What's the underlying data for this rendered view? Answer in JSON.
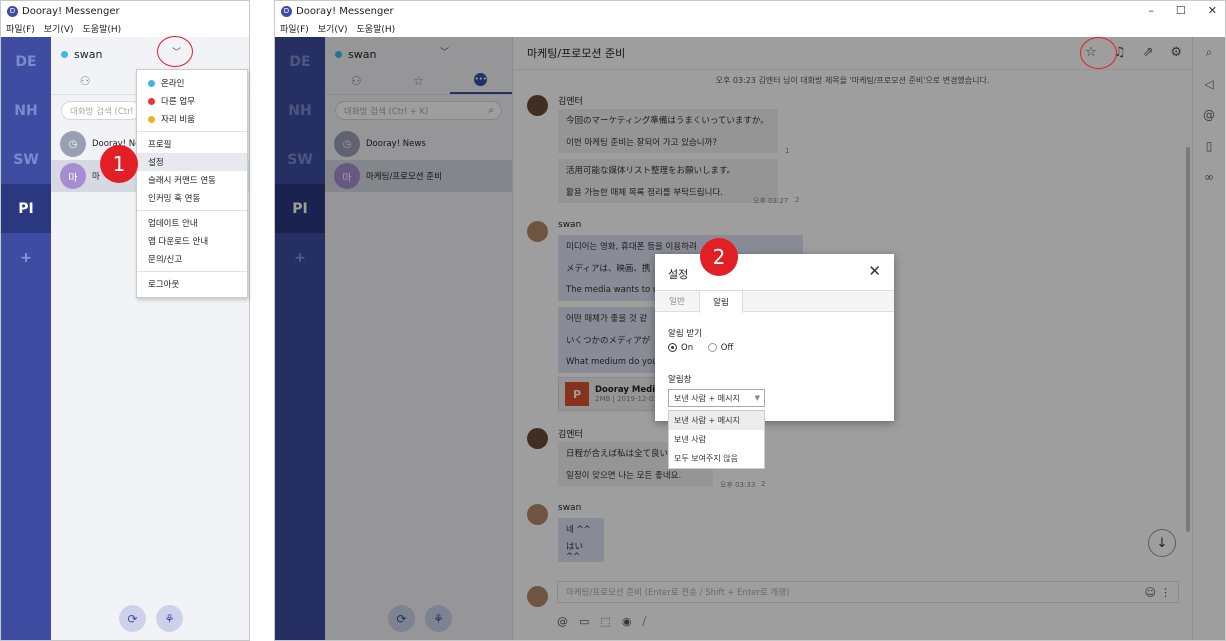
{
  "app_title": "Dooray! Messenger",
  "menu": [
    "파일(F)",
    "보기(V)",
    "도움말(H)"
  ],
  "window_controls": [
    "–",
    "☐",
    "✕"
  ],
  "workspaces": [
    "DE",
    "NH",
    "SW",
    "PI",
    "+"
  ],
  "user": {
    "name": "swan",
    "status_color": "#3fb7e8"
  },
  "search_placeholder_left": "대화방 검색 (Ctrl",
  "search_placeholder": "대화방 검색 (Ctrl + K)",
  "rooms": [
    {
      "name": "Dooray! News",
      "avatar": "◷",
      "avatar_color": "#9aa0b4"
    },
    {
      "name": "마케팅/프로모션 준비",
      "avatar": "마",
      "avatar_color": "#a68dd3"
    }
  ],
  "left_rooms_truncated": [
    "Dooray! Ne",
    "마"
  ],
  "dropdown": {
    "status": [
      {
        "label": "온라인",
        "color": "#3fb7e8"
      },
      {
        "label": "다른 업무",
        "color": "#e8343a"
      },
      {
        "label": "자리 비움",
        "color": "#f2b11b"
      }
    ],
    "group2": [
      "프로필",
      "설정",
      "슬래시 커맨드 연동",
      "인커밍 훅 연동"
    ],
    "group3": [
      "업데이트 안내",
      "앱 다운로드 안내",
      "문의/신고"
    ],
    "group4": [
      "로그아웃"
    ]
  },
  "steps": [
    "1",
    "2"
  ],
  "chat": {
    "title": "마케팅/프로모션 준비",
    "system_message": "오후 03:23  김엔터 님이 대화방 제목을 '마케팅/프로모션 준비'으로 변경했습니다.",
    "messages": [
      {
        "sender": "김엔터",
        "lines": [
          "今回のマーケティング準備はうまくいっていますか。",
          "이번 마케팅 준비는 잘되어 가고 있습니까?"
        ],
        "count": "1"
      },
      {
        "sender": "",
        "lines": [
          "活用可能な媒体リスト整理をお願いします。",
          "활용 가능한 매체 목록 정리를 부탁드립니다."
        ],
        "time": "오후 03:27",
        "count": "2"
      },
      {
        "sender": "swan",
        "lines": [
          "미디어는 영화, 휴대폰 등을 이용하려",
          "メディアは、映画、携",
          "The media wants to u"
        ]
      },
      {
        "sender": "",
        "lines": [
          "어떤 매체가 좋을 것 같",
          "いくつかのメディアが",
          "What medium do you"
        ]
      },
      {
        "sender": "",
        "file": {
          "name": "Dooray Media.p",
          "meta": "2MB | 2019-12-03"
        }
      },
      {
        "sender": "김엔터",
        "lines": [
          "日程が合えば私は全て良い",
          "일정이 맞으면 나는 모든 좋네요."
        ],
        "time": "오후 03:33",
        "count": "2"
      },
      {
        "sender": "swan",
        "lines": [
          "네 ^^",
          "はい^^"
        ]
      }
    ],
    "composer_placeholder": "마케팅/프로모션 준비  (Enter로 전송 / Shift + Enter로 개행)"
  },
  "settings_dialog": {
    "title": "설정",
    "tabs": [
      "일반",
      "알림"
    ],
    "active_tab": "알림",
    "receive_label": "알림 받기",
    "on_label": "On",
    "off_label": "Off",
    "popup_label": "알림창",
    "selected": "보낸 사람 + 메시지",
    "options": [
      "보낸 사람 + 메시지",
      "보낸 사람",
      "모두 보여주지 않음"
    ]
  }
}
